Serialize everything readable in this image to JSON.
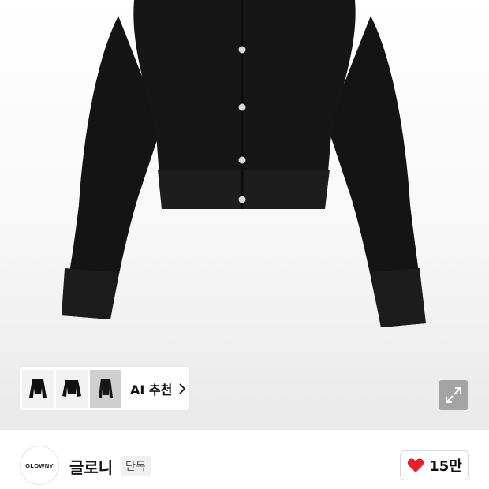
{
  "product": {
    "image_alt": "black cardigan",
    "ai_recommend_label": "AI 추천",
    "thumbnails": [
      {
        "name": "cardigan-thumb-1",
        "selected": false
      },
      {
        "name": "cardigan-thumb-2",
        "selected": false
      },
      {
        "name": "cardigan-thumb-3",
        "selected": true
      }
    ]
  },
  "brand": {
    "logo_text": "GLOWNY",
    "name": "글로니",
    "badge": "단독"
  },
  "like": {
    "count": "15만",
    "heart_color": "#e8202a"
  },
  "icons": {
    "expand": "expand-arrows-icon",
    "chevron": "chevron-right-icon",
    "heart": "heart-icon"
  }
}
